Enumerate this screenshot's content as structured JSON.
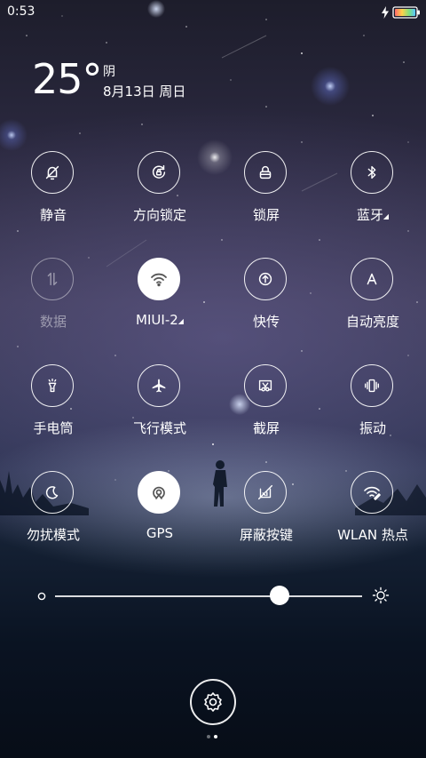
{
  "status_bar": {
    "time": "0:53",
    "icons": [
      "charging-bolt-icon",
      "battery-icon"
    ]
  },
  "weather": {
    "temperature": "25°",
    "condition": "阴",
    "date": "8月13日 周日"
  },
  "toggles": [
    {
      "label": "静音",
      "icon": "bell-off-icon",
      "active": false,
      "dim": false
    },
    {
      "label": "方向锁定",
      "icon": "rotation-lock-icon",
      "active": false,
      "dim": false
    },
    {
      "label": "锁屏",
      "icon": "lock-icon",
      "active": false,
      "dim": false
    },
    {
      "label": "蓝牙",
      "icon": "bluetooth-icon",
      "active": false,
      "dim": false,
      "has_more": true
    },
    {
      "label": "数据",
      "icon": "mobile-data-icon",
      "active": false,
      "dim": true
    },
    {
      "label": "MIUI-2",
      "icon": "wifi-icon",
      "active": true,
      "dim": false,
      "has_more": true
    },
    {
      "label": "快传",
      "icon": "quick-transfer-icon",
      "active": false,
      "dim": false
    },
    {
      "label": "自动亮度",
      "icon": "auto-brightness-icon",
      "active": false,
      "dim": false
    },
    {
      "label": "手电筒",
      "icon": "flashlight-icon",
      "active": false,
      "dim": false
    },
    {
      "label": "飞行模式",
      "icon": "airplane-icon",
      "active": false,
      "dim": false
    },
    {
      "label": "截屏",
      "icon": "screenshot-icon",
      "active": false,
      "dim": false
    },
    {
      "label": "振动",
      "icon": "vibrate-icon",
      "active": false,
      "dim": false
    },
    {
      "label": "勿扰模式",
      "icon": "moon-icon",
      "active": false,
      "dim": false
    },
    {
      "label": "GPS",
      "icon": "gps-icon",
      "active": true,
      "dim": false
    },
    {
      "label": "屏蔽按键",
      "icon": "block-keys-icon",
      "active": false,
      "dim": false
    },
    {
      "label": "WLAN 热点",
      "icon": "hotspot-icon",
      "active": false,
      "dim": false
    }
  ],
  "brightness": {
    "level": 0.73,
    "low_icon": "brightness-low-icon",
    "high_icon": "brightness-high-icon"
  },
  "settings": {
    "icon": "settings-gear-icon"
  },
  "pager": {
    "pages": 2,
    "current": 2
  },
  "colors": {
    "active_toggle_bg": "#ffffff",
    "active_icon": "#555555",
    "icon": "#ffffff",
    "dim": "rgba(255,255,255,0.45)"
  }
}
